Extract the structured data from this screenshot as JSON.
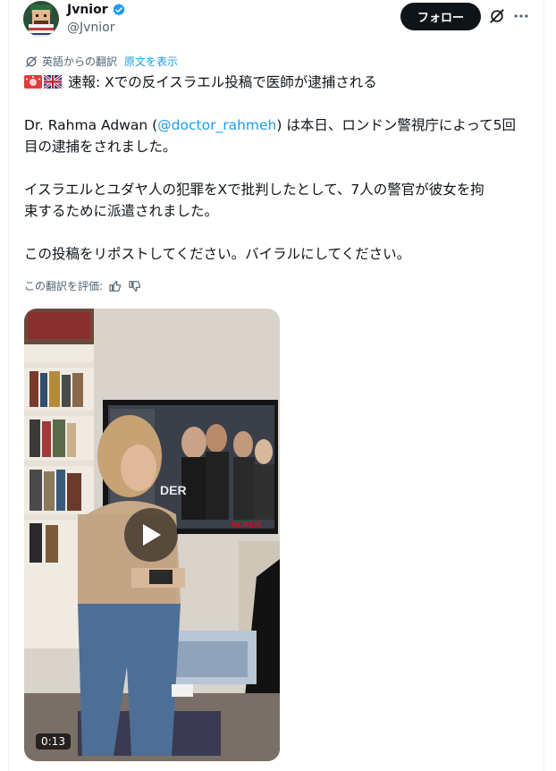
{
  "author": {
    "name": "Jvnior",
    "handle": "@Jvnior",
    "verified_color": "#1d9bf0"
  },
  "actions": {
    "follow_label": "フォロー",
    "grok_icon": "grok-icon",
    "more_icon": "more-icon"
  },
  "translation": {
    "label": "英語からの翻訳",
    "show_original": "原文を表示",
    "rate_label": "この翻訳を評価:"
  },
  "post": {
    "line1_text": "速報: Xでの反イスラエル投稿で医師が逮捕される",
    "p2_prefix": "Dr. Rahma Adwan (",
    "p2_mention": "@doctor_rahmeh",
    "p2_suffix": ") は本日、ロンドン警視庁によって5回",
    "p2_line2": "目の逮捕をされました。",
    "p3_line1": "イスラエルとユダヤ人の犯罪をXで批判したとして、7人の警官が彼女を拘",
    "p3_line2": "束するために派遣されました。",
    "p4": "この投稿をリポストしてください。バイラルにしてください。"
  },
  "media": {
    "tv_text_left": "DER",
    "tv_brand": "NETFLIX",
    "duration": "0:13"
  },
  "colors": {
    "accent": "#1d9bf0",
    "text": "#0f1419",
    "muted": "#536471",
    "button": "#0f1419"
  }
}
